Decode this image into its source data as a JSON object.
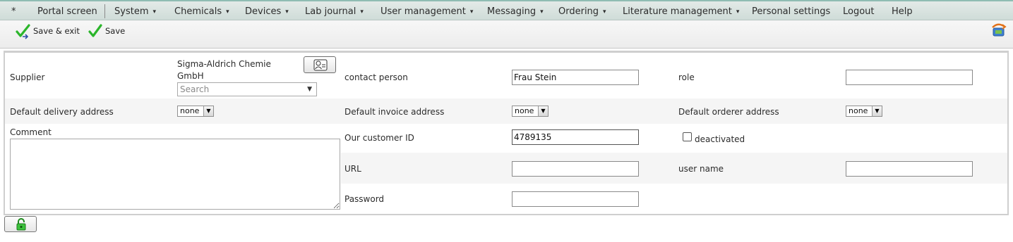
{
  "menu": {
    "items": [
      {
        "label": "*",
        "has_dropdown": false
      },
      {
        "label": "Portal screen",
        "has_dropdown": false
      },
      {
        "label": "System",
        "has_dropdown": true
      },
      {
        "label": "Chemicals",
        "has_dropdown": true
      },
      {
        "label": "Devices",
        "has_dropdown": true
      },
      {
        "label": "Lab journal",
        "has_dropdown": true
      },
      {
        "label": "User management",
        "has_dropdown": true
      },
      {
        "label": "Messaging",
        "has_dropdown": true
      },
      {
        "label": "Ordering",
        "has_dropdown": true
      },
      {
        "label": "Literature management",
        "has_dropdown": true
      },
      {
        "label": "Personal settings",
        "has_dropdown": false
      },
      {
        "label": "Logout",
        "has_dropdown": false
      },
      {
        "label": "Help",
        "has_dropdown": false
      }
    ],
    "caret": "▾"
  },
  "toolbar": {
    "save_exit_label": "Save & exit",
    "save_label": "Save",
    "icons": {
      "save_exit": "check-icon",
      "save": "check-icon",
      "corner": "transfer-icon"
    }
  },
  "form": {
    "supplier": {
      "label": "Supplier",
      "value": "Sigma-Aldrich Chemie GmbH",
      "search_placeholder": "Search",
      "lookup_icon": "lookup-card-icon"
    },
    "contact_person": {
      "label": "contact person",
      "value": "Frau Stein"
    },
    "role": {
      "label": "role",
      "value": ""
    },
    "default_delivery_address": {
      "label": "Default delivery address",
      "value": "none"
    },
    "default_invoice_address": {
      "label": "Default invoice address",
      "value": "none"
    },
    "default_orderer_address": {
      "label": "Default orderer address",
      "value": "none"
    },
    "comment": {
      "label": "Comment",
      "value": ""
    },
    "our_customer_id": {
      "label": "Our customer ID",
      "value": "4789135"
    },
    "deactivated": {
      "label": "deactivated",
      "checked": false
    },
    "url": {
      "label": "URL",
      "value": ""
    },
    "user_name": {
      "label": "user name",
      "value": ""
    },
    "password": {
      "label": "Password",
      "value": ""
    }
  },
  "footer": {
    "lock_icon": "unlocked-lock-icon"
  },
  "colors": {
    "menu_border": "#8fbcb3",
    "check_green": "#2bb52b",
    "row_shade": "#f5f5f5"
  }
}
